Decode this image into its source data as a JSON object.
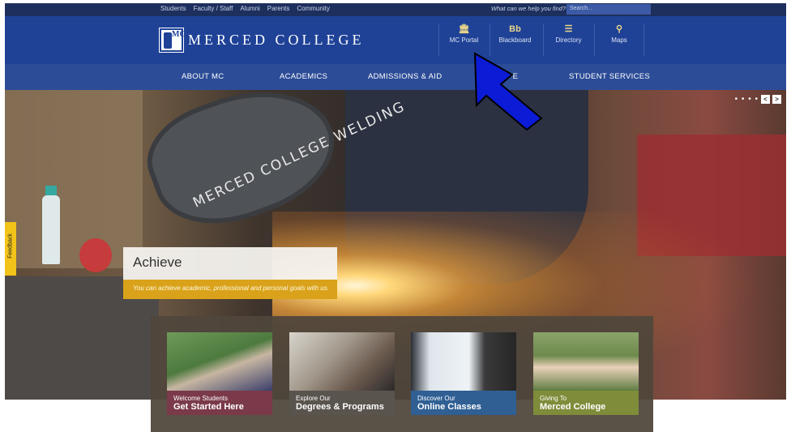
{
  "utility": {
    "links": [
      "Students",
      "Faculty / Staff",
      "Alumni",
      "Parents",
      "Community"
    ],
    "help_text": "What can we help you find?",
    "search_placeholder": "Search..."
  },
  "header": {
    "site_title": "MERCED COLLEGE",
    "logo_text": "MC",
    "quick_links": [
      {
        "icon": "building-icon",
        "glyph": "🏛",
        "label": "MC Portal"
      },
      {
        "icon": "blackboard-icon",
        "glyph": "Bb",
        "label": "Blackboard"
      },
      {
        "icon": "list-icon",
        "glyph": "☰",
        "label": "Directory"
      },
      {
        "icon": "map-pin-icon",
        "glyph": "⚲",
        "label": "Maps"
      }
    ]
  },
  "nav": {
    "items": [
      "ABOUT MC",
      "ACADEMICS",
      "ADMISSIONS & AID",
      "LIFE",
      "STUDENT SERVICES"
    ]
  },
  "hero": {
    "shield_text": "MERCED COLLEGE WELDING",
    "slide_title": "Achieve",
    "slide_tagline": "You can achieve academic, professional and personal goals with us.",
    "feedback_label": "Feedback",
    "slider_dots": "• • • •",
    "prev_glyph": "<",
    "next_glyph": ">"
  },
  "tiles": [
    {
      "small": "Welcome Students",
      "big": "Get Started Here",
      "color": "#7a3a4a"
    },
    {
      "small": "Explore Our",
      "big": "Degrees & Programs",
      "color": "#5a544e"
    },
    {
      "small": "Discover Our",
      "big": "Online Classes",
      "color": "#2f5f93"
    },
    {
      "small": "Giving To",
      "big": "Merced College",
      "color": "#7f8c3a"
    }
  ],
  "colors": {
    "header_blue": "#1f4297",
    "nav_blue": "#2c4c97",
    "utility_navy": "#1d2f5c",
    "gold": "#d9a21a",
    "annotation_arrow": "#0b1bd6"
  }
}
